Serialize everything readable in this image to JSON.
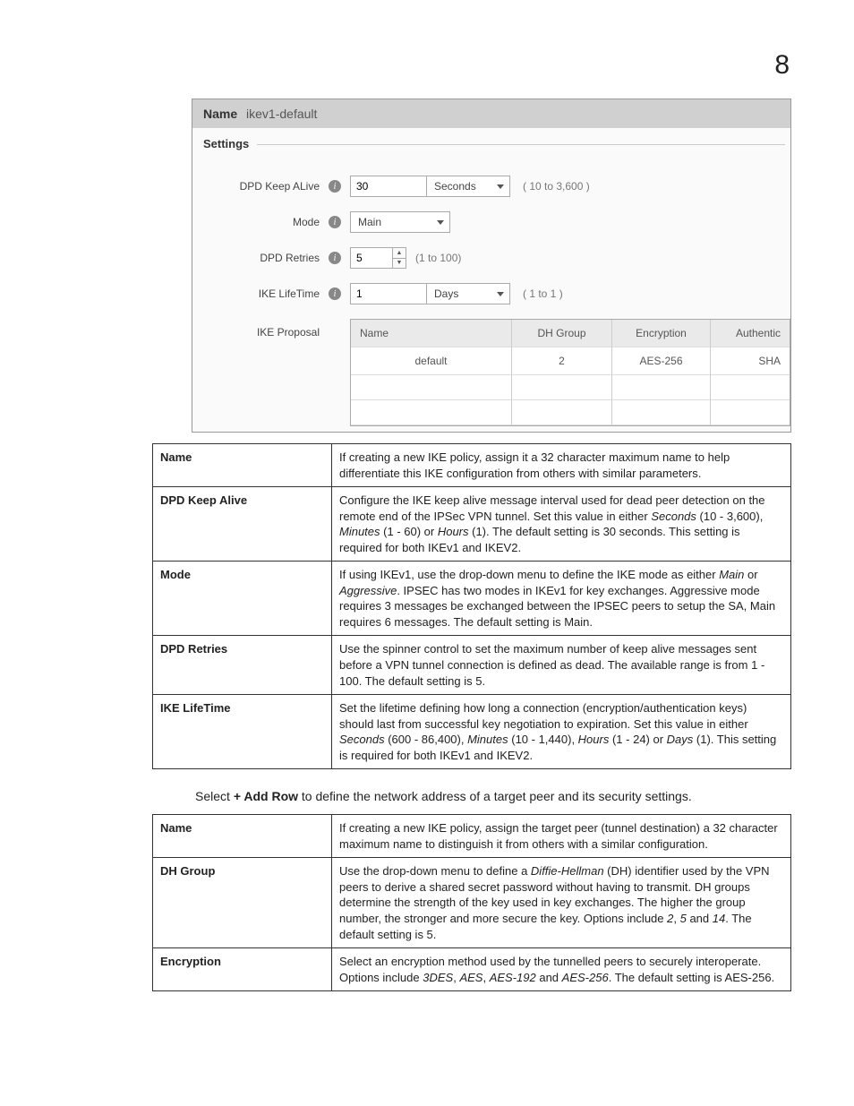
{
  "page_number": "8",
  "panel": {
    "name_label": "Name",
    "name_value": "ikev1-default",
    "fieldset": "Settings",
    "dpd_keepalive_label": "DPD Keep ALive",
    "dpd_keepalive_value": "30",
    "dpd_keepalive_unit": "Seconds",
    "dpd_keepalive_range": "( 10 to 3,600 )",
    "mode_label": "Mode",
    "mode_value": "Main",
    "dpd_retries_label": "DPD Retries",
    "dpd_retries_value": "5",
    "dpd_retries_range": "(1 to 100)",
    "ike_lifetime_label": "IKE LifeTime",
    "ike_lifetime_value": "1",
    "ike_lifetime_unit": "Days",
    "ike_lifetime_range": "( 1 to 1 )",
    "ike_proposal_label": "IKE Proposal",
    "proposal_headers": {
      "name": "Name",
      "dh": "DH Group",
      "enc": "Encryption",
      "auth": "Authentic"
    },
    "proposal_row": {
      "name": "default",
      "dh": "2",
      "enc": "AES-256",
      "auth": "SHA"
    }
  },
  "desc1": {
    "name_label": "Name",
    "name_text": "If creating a new IKE policy, assign it a 32 character maximum name to help differentiate this IKE configuration from others with similar parameters.",
    "dpd_keepalive_label": "DPD Keep Alive",
    "dpd_keepalive_pre": "Configure the IKE keep alive message interval used for dead peer detection on the remote end of the IPSec VPN tunnel. Set this value in either ",
    "dpd_keepalive_seconds": "Seconds",
    "dpd_keepalive_seconds_range": " (10 - 3,600), ",
    "dpd_keepalive_minutes": "Minutes",
    "dpd_keepalive_minutes_range": " (1 - 60) or ",
    "dpd_keepalive_hours": "Hours",
    "dpd_keepalive_post": " (1). The default setting is 30 seconds. This setting is required for both IKEv1 and IKEV2.",
    "mode_label": "Mode",
    "mode_pre": "If using IKEv1, use the drop-down menu to define the IKE mode as either ",
    "mode_main": "Main",
    "mode_or": " or ",
    "mode_aggr": "Aggressive",
    "mode_post": ". IPSEC has two modes in IKEv1 for key exchanges. Aggressive mode requires 3 messages be exchanged between the IPSEC peers to setup the SA, Main requires 6 messages. The default setting is Main.",
    "dpd_retries_label": "DPD Retries",
    "dpd_retries_text": "Use the spinner control to set the maximum number of keep alive messages sent before a VPN tunnel connection is defined as dead. The available range is from 1 - 100. The default setting is 5.",
    "ike_lifetime_label": "IKE LifeTime",
    "ike_lifetime_pre": "Set the lifetime defining how long a connection (encryption/authentication keys) should last from successful key negotiation to expiration. Set this value in either ",
    "ike_lifetime_seconds": "Seconds",
    "ike_lifetime_seconds_range": " (600 - 86,400), ",
    "ike_lifetime_minutes": "Minutes",
    "ike_lifetime_minutes_range": " (10 - 1,440), ",
    "ike_lifetime_hours": "Hours",
    "ike_lifetime_hours_range": " (1 - 24) or ",
    "ike_lifetime_days": "Days",
    "ike_lifetime_post": " (1). This setting is required for both IKEv1 and IKEV2."
  },
  "mid_text_pre": "Select ",
  "mid_text_bold": "+ Add Row",
  "mid_text_post": " to define the network address of a target peer and its security settings.",
  "desc2": {
    "name_label": "Name",
    "name_text": "If creating a new IKE policy, assign the target peer (tunnel destination) a 32 character maximum name to distinguish it from others with a similar configuration.",
    "dh_label": "DH Group",
    "dh_pre": "Use the drop-down menu to define a ",
    "dh_italic": "Diffie-Hellman",
    "dh_mid": " (DH) identifier used by the VPN peers to derive a shared secret password without having to transmit. DH groups determine the strength of the key used in key exchanges. The higher the group number, the stronger and more secure the key. Options include ",
    "dh_2": "2",
    "dh_c1": ", ",
    "dh_5": "5",
    "dh_and": " and ",
    "dh_14": "14",
    "dh_post": ". The default setting is 5.",
    "enc_label": "Encryption",
    "enc_pre": "Select an encryption method used by the tunnelled peers to securely interoperate. Options include ",
    "enc_3des": "3DES",
    "enc_c1": ", ",
    "enc_aes": "AES",
    "enc_c2": ", ",
    "enc_aes192": "AES-192",
    "enc_and": " and ",
    "enc_aes256": "AES-256",
    "enc_post": ". The default setting is AES-256."
  }
}
